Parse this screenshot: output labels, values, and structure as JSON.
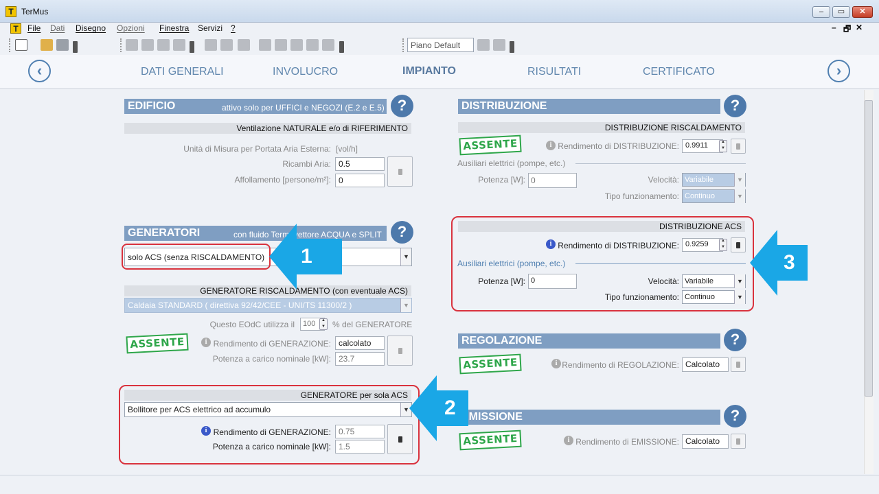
{
  "window": {
    "title": "TerMus",
    "app_icon": "T",
    "controls": {
      "minimize": "–",
      "maximize": "▭",
      "close": "✕"
    }
  },
  "menu": {
    "app_icon": "T",
    "items": [
      "File",
      "Dati",
      "Disegno",
      "Opzioni",
      "Finestra",
      "Servizi",
      "?"
    ],
    "mdi": {
      "minimize": "–",
      "restore": "🗗",
      "close": "✕"
    }
  },
  "toolbar": {
    "plan_combo": "Piano Default"
  },
  "nav": {
    "prev": "‹",
    "next": "›",
    "tabs": [
      "DATI GENERALI",
      "INVOLUCRO",
      "IMPIANTO",
      "RISULTATI",
      "CERTIFICATO"
    ],
    "active": "IMPIANTO"
  },
  "help_label": "?",
  "edificio": {
    "title": "EDIFICIO",
    "note": "attivo solo per UFFICI e NEGOZI (E.2 e E.5)",
    "sub": "Ventilazione NATURALE e/o di RIFERIMENTO",
    "rows": [
      {
        "label": "Unità di Misura per Portata Aria Esterna:",
        "value": "[vol/h]"
      },
      {
        "label": "Ricambi Aria:",
        "value": "0.5"
      },
      {
        "label": "Affollamento [persone/m²]:",
        "value": "0"
      }
    ]
  },
  "generatori": {
    "title": "GENERATORI",
    "note": "con fluido Termovettore ACQUA e SPLIT",
    "mode": "solo ACS (senza RISCALDAMENTO)",
    "risc": {
      "sub": "GENERATORE RISCALDAMENTO (con eventuale ACS)",
      "type": "Caldaia STANDARD  ( direttiva 92/42/CEE - UNI/TS 11300/2 )",
      "usage_prefix": "Questo EOdC utilizza il",
      "usage_value": "100",
      "usage_suffix": "%  del GENERATORE",
      "absent": "ASSENTE",
      "rend_label": "Rendimento di GENERAZIONE:",
      "rend_value": "calcolato",
      "power_label": "Potenza a carico nominale [kW]:",
      "power_value": "23.7"
    },
    "acs": {
      "sub": "GENERATORE per sola ACS",
      "type": "Bollitore per ACS elettrico ad accumulo",
      "rend_label": "Rendimento di GENERAZIONE:",
      "rend_value": "0.75",
      "power_label": "Potenza a carico nominale [kW]:",
      "power_value": "1.5"
    }
  },
  "distribuzione": {
    "title": "DISTRIBUZIONE",
    "risc": {
      "sub": "DISTRIBUZIONE RISCALDAMENTO",
      "absent": "ASSENTE",
      "rend_label": "Rendimento di DISTRIBUZIONE:",
      "rend_value": "0.9911",
      "aux": "Ausiliari elettrici (pompe, etc.)",
      "power_label": "Potenza [W]:",
      "power_value": "0",
      "speed_label": "Velocità:",
      "speed_value": "Variabile",
      "mode_label": "Tipo funzionamento:",
      "mode_value": "Continuo"
    },
    "acs": {
      "sub": "DISTRIBUZIONE ACS",
      "rend_label": "Rendimento di DISTRIBUZIONE:",
      "rend_value": "0.9259",
      "aux": "Ausiliari elettrici (pompe, etc.)",
      "power_label": "Potenza [W]:",
      "power_value": "0",
      "speed_label": "Velocità:",
      "speed_value": "Variabile",
      "mode_label": "Tipo funzionamento:",
      "mode_value": "Continuo"
    }
  },
  "regolazione": {
    "title": "REGOLAZIONE",
    "absent": "ASSENTE",
    "rend_label": "Rendimento di REGOLAZIONE:",
    "rend_value": "Calcolato"
  },
  "emissione": {
    "title": "EMISSIONE",
    "absent": "ASSENTE",
    "rend_label": "Rendimento di EMISSIONE:",
    "rend_value": "Calcolato"
  },
  "callouts": [
    "1",
    "2",
    "3"
  ],
  "info_glyph": "i",
  "dd_glyph": "▼",
  "colors": {
    "accent": "#7f9ec2",
    "callout": "#1aa7e6",
    "highlight": "#d9323d",
    "absent": "#2ea64a"
  }
}
